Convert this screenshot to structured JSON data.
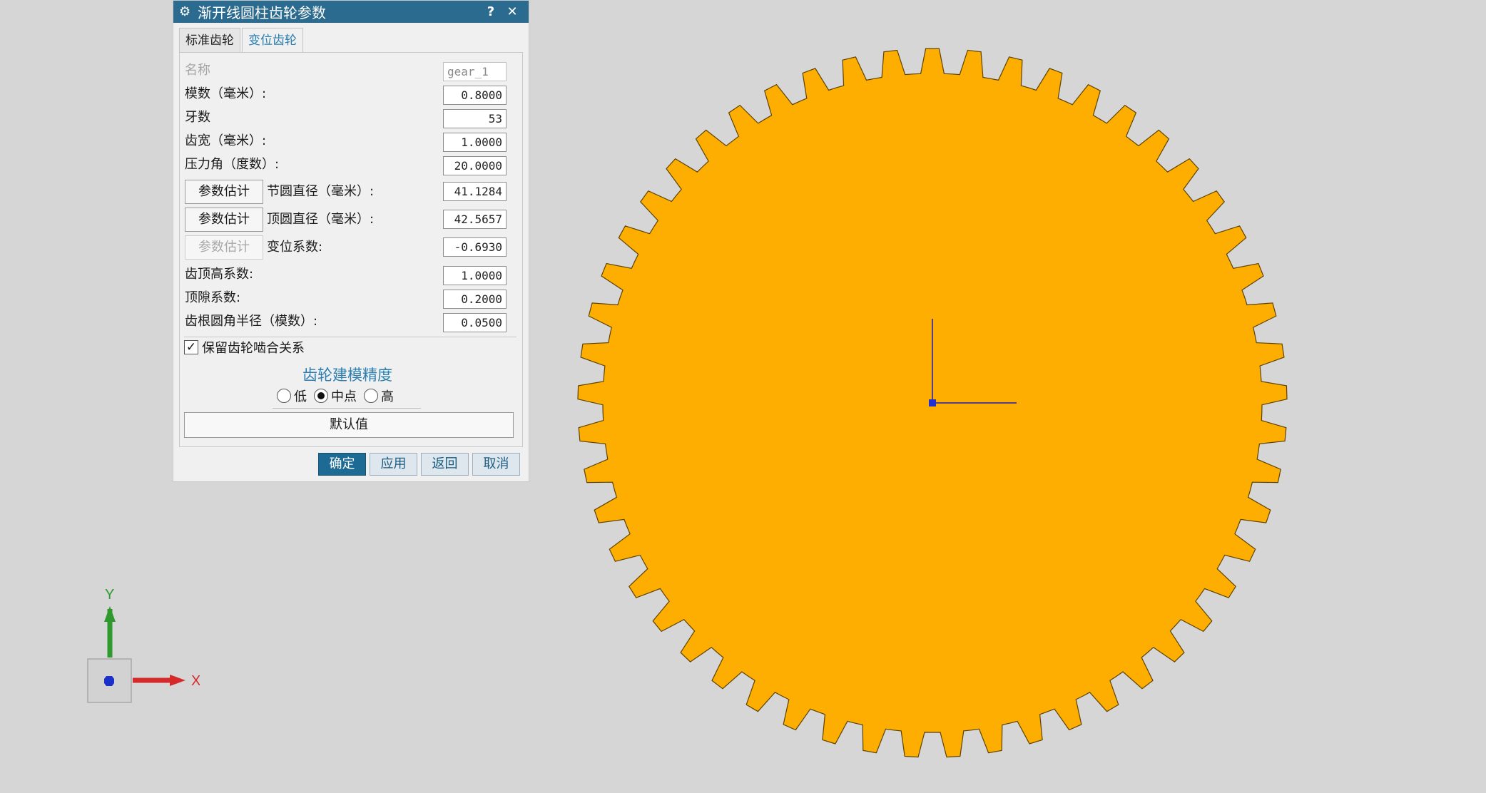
{
  "dialog": {
    "title": "渐开线圆柱齿轮参数",
    "help_glyph": "?",
    "close_glyph": "✕",
    "tabs": [
      {
        "label": "标准齿轮",
        "active": false
      },
      {
        "label": "变位齿轮",
        "active": true
      }
    ],
    "fields": {
      "name": {
        "label": "名称",
        "value": "gear_1"
      },
      "module": {
        "label": "模数（毫米）:",
        "value": "0.8000"
      },
      "teeth": {
        "label": "牙数",
        "value": "53"
      },
      "face_width": {
        "label": "齿宽（毫米）:",
        "value": "1.0000"
      },
      "pressure_angle": {
        "label": "压力角（度数）:",
        "value": "20.0000"
      },
      "pitch_diameter": {
        "label": "节圆直径（毫米）:",
        "value": "41.1284",
        "button": "参数估计"
      },
      "tip_diameter": {
        "label": "顶圆直径（毫米）:",
        "value": "42.5657",
        "button": "参数估计"
      },
      "shift_coef": {
        "label": "变位系数:",
        "value": "-0.6930",
        "button": "参数估计"
      },
      "addendum_coef": {
        "label": "齿顶高系数:",
        "value": "1.0000"
      },
      "clearance_coef": {
        "label": "顶隙系数:",
        "value": "0.2000"
      },
      "root_fillet": {
        "label": "齿根圆角半径（模数）:",
        "value": "0.0500"
      }
    },
    "keep_mesh": {
      "label": "保留齿轮啮合关系",
      "checked": true
    },
    "precision": {
      "title": "齿轮建模精度",
      "options": [
        "低",
        "中点",
        "高"
      ],
      "selected": "中点"
    },
    "default_button": "默认值",
    "footer": {
      "ok": "确定",
      "apply": "应用",
      "back": "返回",
      "cancel": "取消"
    }
  },
  "gear": {
    "teeth": 53,
    "fill": "#fdae00",
    "outline": "#6a4a00"
  },
  "axes": {
    "x_label": "X",
    "y_label": "Y",
    "x_color": "#d62a2a",
    "y_color": "#2e9a2e"
  },
  "colors": {
    "accent": "#2a6b8f",
    "tab_active": "#2b7fb0"
  }
}
